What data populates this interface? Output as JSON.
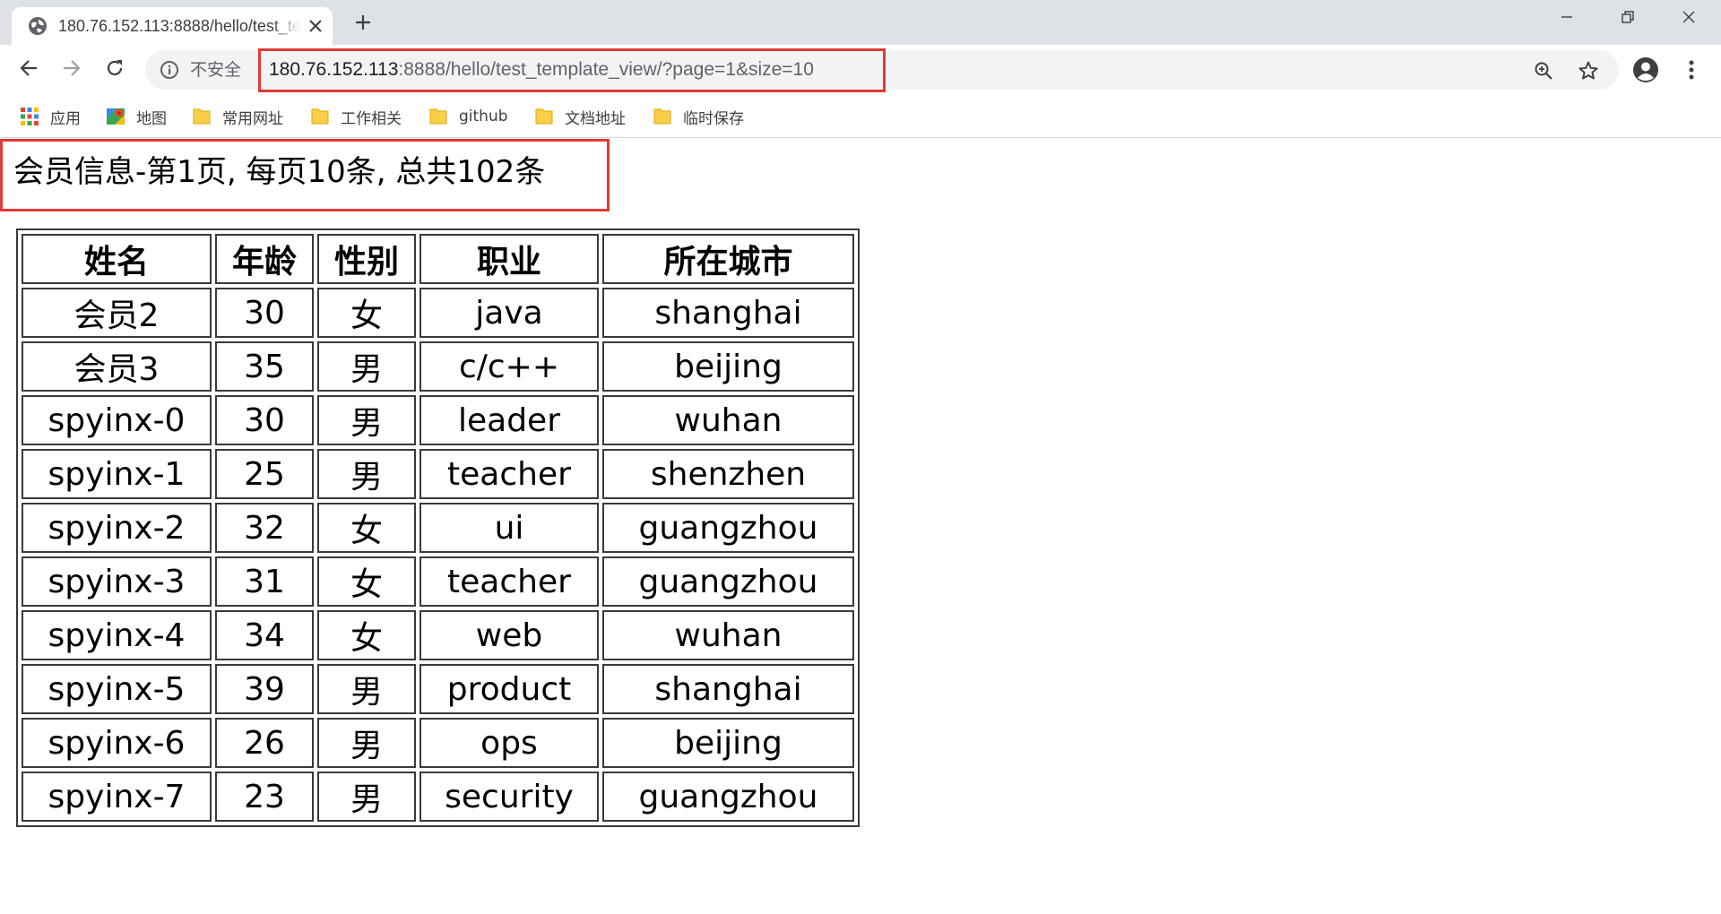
{
  "browser": {
    "tab_title": "180.76.152.113:8888/hello/test_template_view/?page=1&size=10",
    "security_label": "不安全",
    "url_host": "180.76.152.113",
    "url_rest": ":8888/hello/test_template_view/?page=1&size=10",
    "bookmarks": [
      {
        "label": "应用",
        "icon": "apps-grid-icon"
      },
      {
        "label": "地图",
        "icon": "maps-icon"
      },
      {
        "label": "常用网址",
        "icon": "folder-icon"
      },
      {
        "label": "工作相关",
        "icon": "folder-icon"
      },
      {
        "label": "github",
        "icon": "folder-icon"
      },
      {
        "label": "文档地址",
        "icon": "folder-icon"
      },
      {
        "label": "临时保存",
        "icon": "folder-icon"
      }
    ]
  },
  "page": {
    "heading": "会员信息-第1页, 每页10条, 总共102条",
    "table": {
      "headers": [
        "姓名",
        "年龄",
        "性别",
        "职业",
        "所在城市"
      ],
      "rows": [
        [
          "会员2",
          "30",
          "女",
          "java",
          "shanghai"
        ],
        [
          "会员3",
          "35",
          "男",
          "c/c++",
          "beijing"
        ],
        [
          "spyinx-0",
          "30",
          "男",
          "leader",
          "wuhan"
        ],
        [
          "spyinx-1",
          "25",
          "男",
          "teacher",
          "shenzhen"
        ],
        [
          "spyinx-2",
          "32",
          "女",
          "ui",
          "guangzhou"
        ],
        [
          "spyinx-3",
          "31",
          "女",
          "teacher",
          "guangzhou"
        ],
        [
          "spyinx-4",
          "34",
          "女",
          "web",
          "wuhan"
        ],
        [
          "spyinx-5",
          "39",
          "男",
          "product",
          "shanghai"
        ],
        [
          "spyinx-6",
          "26",
          "男",
          "ops",
          "beijing"
        ],
        [
          "spyinx-7",
          "23",
          "男",
          "security",
          "guangzhou"
        ]
      ]
    }
  },
  "colors": {
    "highlight_red": "#e53935",
    "tabstrip_bg": "#dee1e6",
    "omnibox_bg": "#f1f3f4",
    "folder_yellow": "#f9cf4a"
  }
}
